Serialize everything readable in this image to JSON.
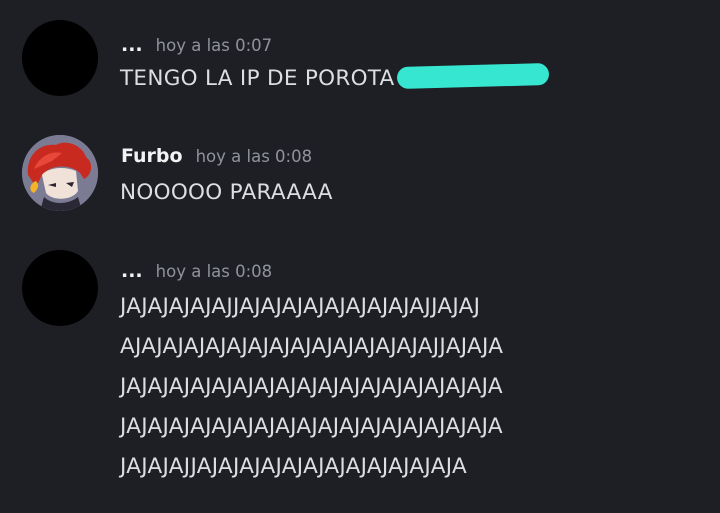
{
  "messages": [
    {
      "avatar": "black-circle-avatar",
      "username": "...",
      "timestamp": "hoy a las 0:07",
      "lines": [
        "TENGO LA IP DE POROTA"
      ],
      "redacted": true
    },
    {
      "avatar": "red-hair-character-avatar",
      "username": "Furbo",
      "timestamp": "hoy a las 0:08",
      "lines": [
        "NOOOOO PARAAAA"
      ]
    },
    {
      "avatar": "black-circle-avatar",
      "username": "...",
      "timestamp": "hoy a las 0:08",
      "lines": [
        "JAJAJAJAJAJJAJAJAJAJAJAJAJAJAJJAJAJ",
        "AJAJAJAJAJAJAJAJAJAJAJAJAJAJAJJAJAJA",
        "JAJAJAJAJAJAJAJAJAJAJAJAJAJAJAJAJAJA",
        "JAJAJAJAJAJAJAJAJAJAJAJAJAJAJAJAJAJA",
        "JAJAJAJJAJAJAJAJAJAJAJAJAJAJAJAJA"
      ]
    }
  ],
  "colors": {
    "background": "#1e1f24",
    "username": "#f2f3f5",
    "timestamp": "#8f939a",
    "text": "#dddee1",
    "redaction_mark": "#36e6d0"
  }
}
